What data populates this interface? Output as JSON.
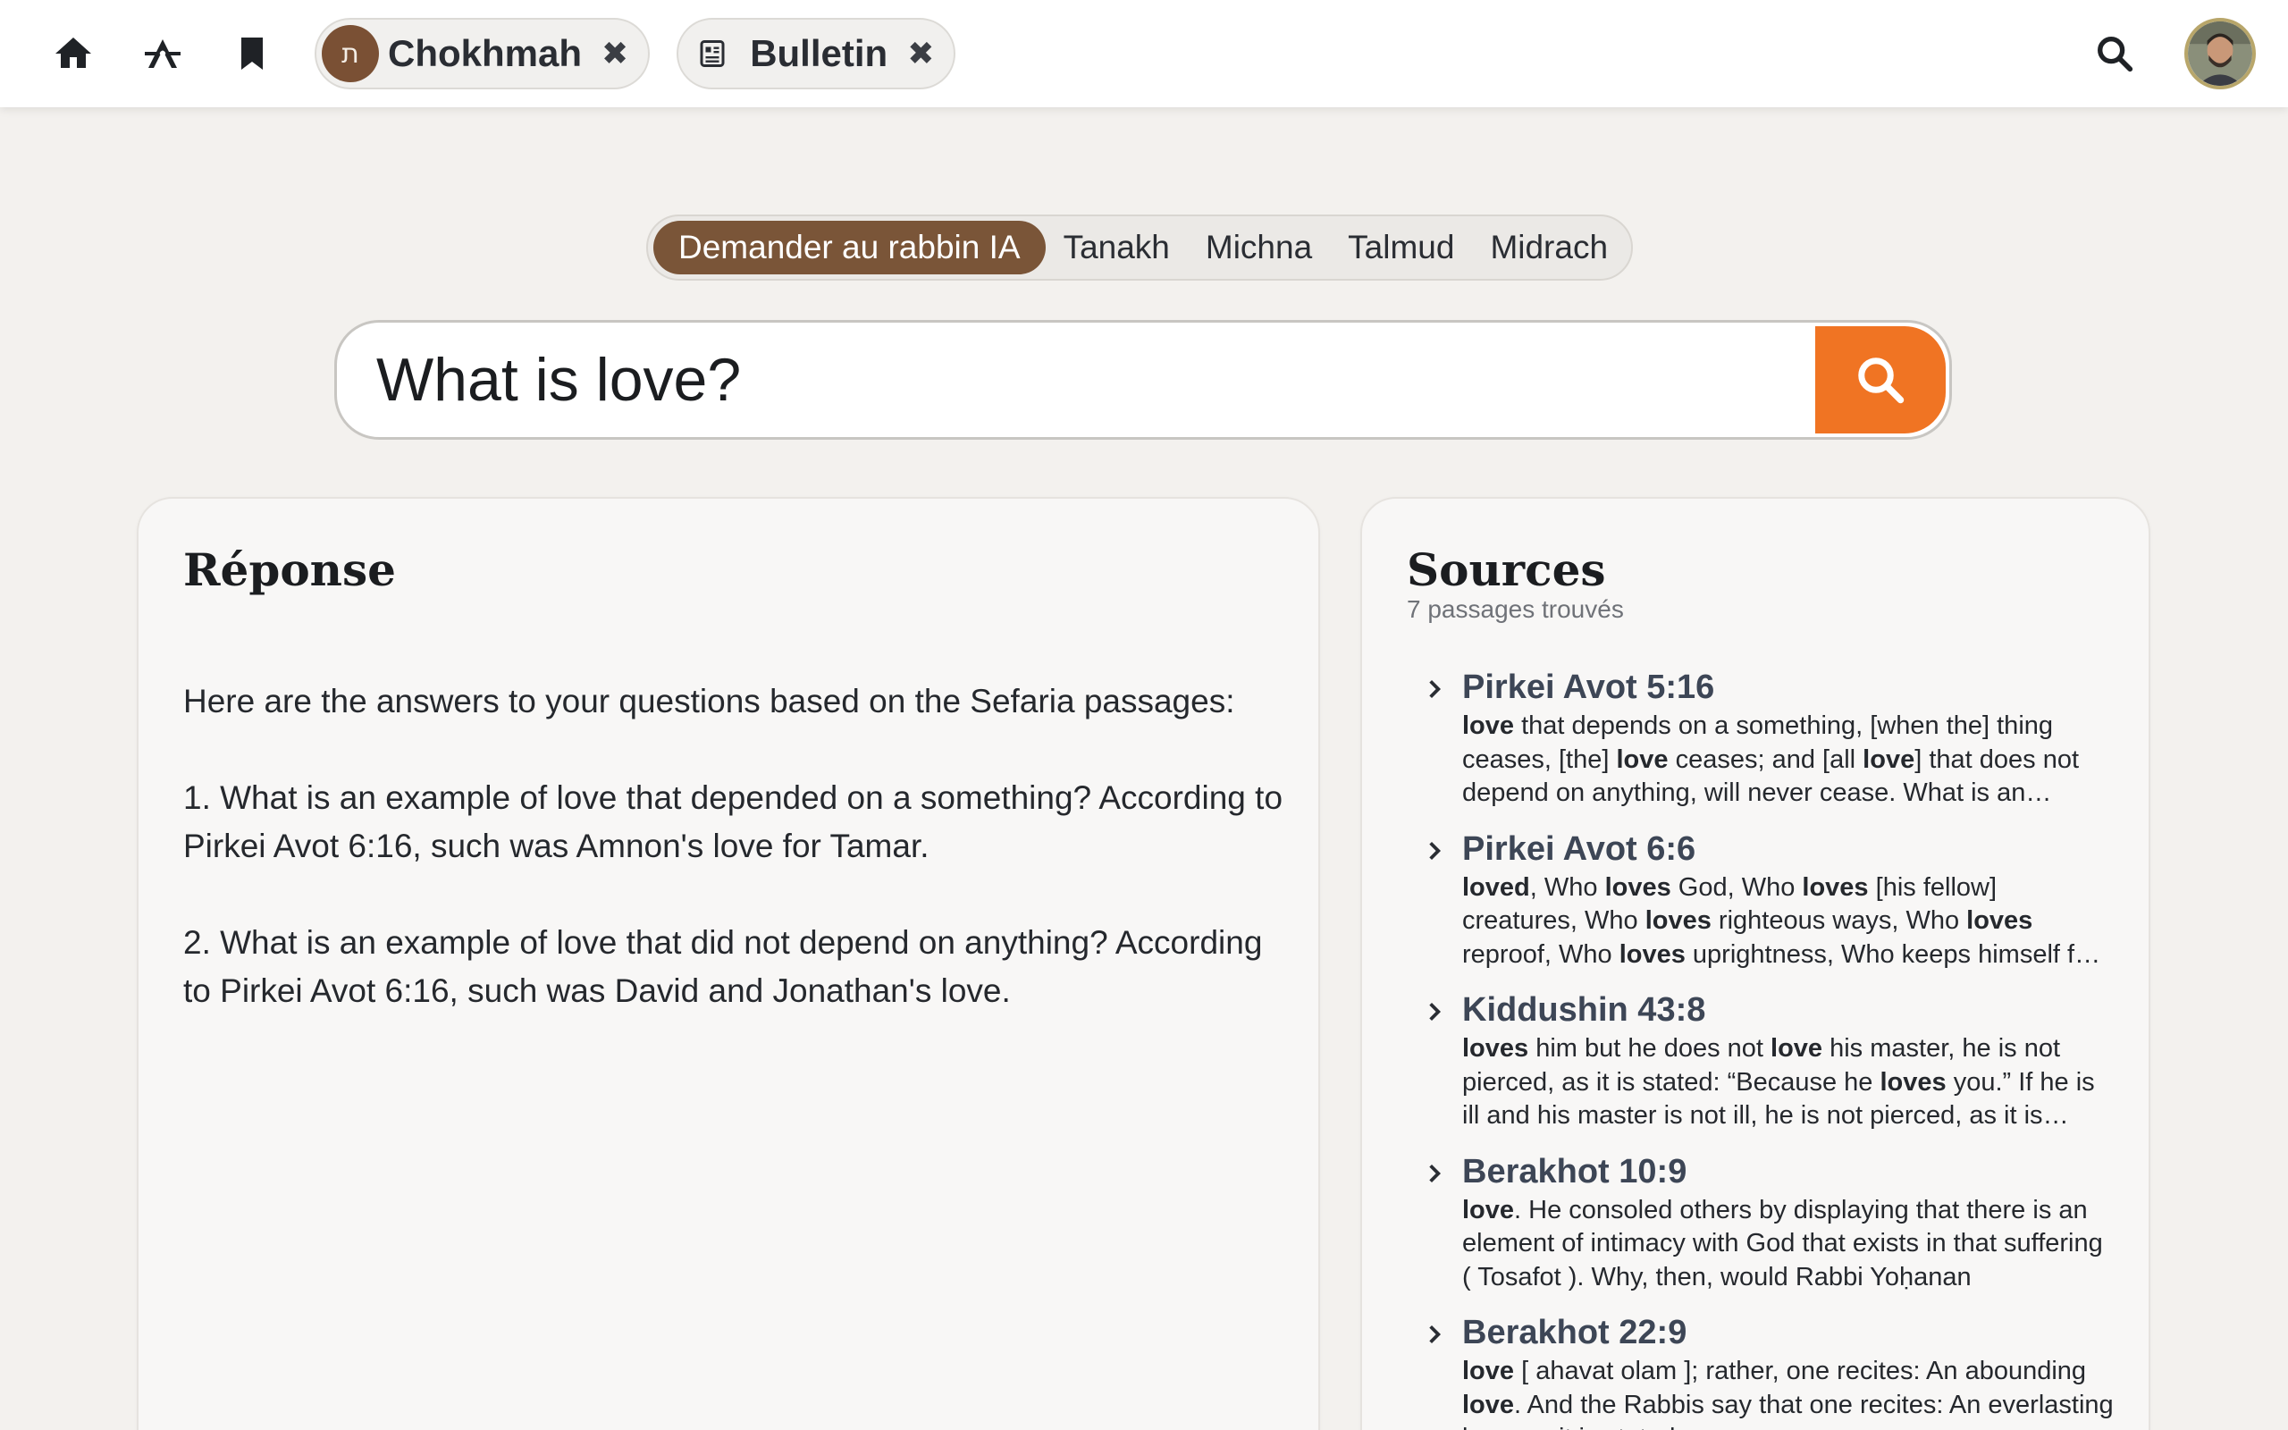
{
  "topbar": {
    "icons": [
      "home-icon",
      "compass-icon",
      "bookmark-icon"
    ],
    "tabs": [
      {
        "label": "Chokhmah",
        "badge": "ת",
        "close": "✖"
      },
      {
        "label": "Bulletin",
        "close": "✖"
      }
    ],
    "search_icon": "search-icon",
    "avatar": "user-avatar"
  },
  "mode_tabs": [
    {
      "label": "Demander au rabbin IA",
      "active": true
    },
    {
      "label": "Tanakh",
      "active": false
    },
    {
      "label": "Michna",
      "active": false
    },
    {
      "label": "Talmud",
      "active": false
    },
    {
      "label": "Midrach",
      "active": false
    }
  ],
  "search": {
    "value": "What is love?"
  },
  "colors": {
    "accent": "#f07423",
    "brand": "#7a5538"
  },
  "answer": {
    "title": "Réponse",
    "paragraphs": [
      "Here are the answers to your questions based on the Sefaria passages:",
      "1. What is an example of love that depended on a something? According to Pirkei Avot 6:16, such was Amnon's love for Tamar.",
      "2. What is an example of love that did not depend on anything? According to Pirkei Avot 6:16, such was David and Jonathan's love."
    ]
  },
  "sources": {
    "title": "Sources",
    "count": "7 passages trouvés",
    "items": [
      {
        "title": "Pirkei Avot 5:16",
        "snippet": "<b>love</b> that depends on a something, [when the] thing ceases, [the] <b>love</b> ceases; and [all <b>love</b>] that does not depend on anything, will never cease. What is an example"
      },
      {
        "title": "Pirkei Avot 6:6",
        "snippet": "<b>loved</b>, Who <b>loves</b> God, Who <b>loves</b> [his fellow] creatures, Who <b>loves</b> righteous ways, Who <b>loves</b> reproof, Who <b>loves</b> uprightness, Who keeps himself far from honor"
      },
      {
        "title": "Kiddushin 43:8",
        "snippet": "<b>loves</b> him but he does not <b>love</b> his master, he is not pierced, as it is stated: “Because he <b>loves</b> you.” If he is ill and his master is not ill, he is not pierced, as it is stated"
      },
      {
        "title": "Berakhot 10:9",
        "snippet": "<b>love</b>. He consoled others by displaying that there is an element of intimacy with God that exists in that suffering ( Tosafot ). Why, then, would Rabbi Yoḥanan"
      },
      {
        "title": "Berakhot 22:9",
        "snippet": "<b>love</b> [ ahavat olam ]; rather, one recites: An abounding <b>love</b>. And the Rabbis say that one recites: An everlasting love, as it is stated"
      }
    ]
  }
}
